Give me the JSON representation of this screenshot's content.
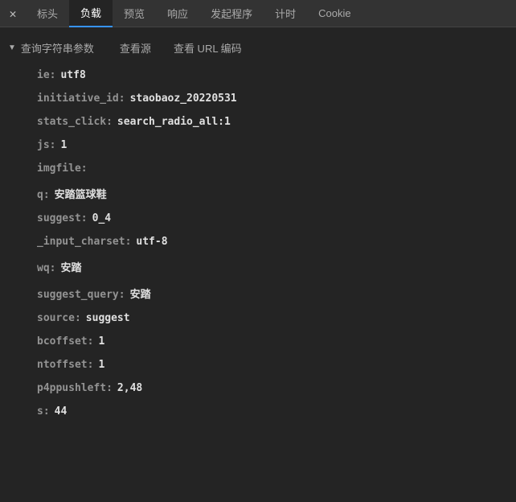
{
  "tabs": {
    "headers": "标头",
    "payload": "负载",
    "preview": "预览",
    "response": "响应",
    "initiator": "发起程序",
    "timing": "计时",
    "cookies": "Cookie"
  },
  "section": {
    "title": "查询字符串参数",
    "viewSource": "查看源",
    "viewUrlEncoded": "查看 URL 编码"
  },
  "params": [
    {
      "key": "ie",
      "value": "utf8"
    },
    {
      "key": "initiative_id",
      "value": "staobaoz_20220531"
    },
    {
      "key": "stats_click",
      "value": "search_radio_all:1"
    },
    {
      "key": "js",
      "value": "1"
    },
    {
      "key": "imgfile",
      "value": ""
    },
    {
      "key": "q",
      "value": "安踏篮球鞋"
    },
    {
      "key": "suggest",
      "value": "0_4"
    },
    {
      "key": "_input_charset",
      "value": "utf-8"
    },
    {
      "key": "wq",
      "value": "安踏"
    },
    {
      "key": "suggest_query",
      "value": "安踏"
    },
    {
      "key": "source",
      "value": "suggest"
    },
    {
      "key": "bcoffset",
      "value": "1"
    },
    {
      "key": "ntoffset",
      "value": "1"
    },
    {
      "key": "p4ppushleft",
      "value": "2,48"
    },
    {
      "key": "s",
      "value": "44"
    }
  ]
}
